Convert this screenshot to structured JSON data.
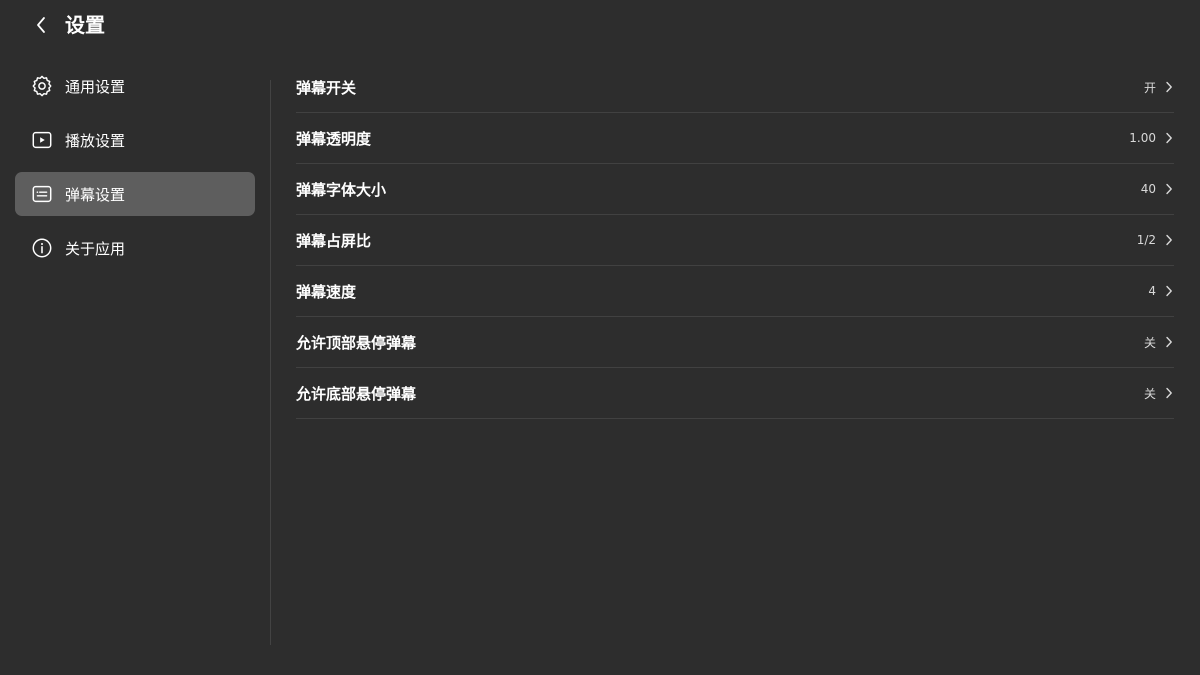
{
  "header": {
    "title": "设置",
    "back_icon": "chevron-left-icon"
  },
  "sidebar": {
    "items": [
      {
        "label": "通用设置",
        "icon": "gear-icon",
        "active": false
      },
      {
        "label": "播放设置",
        "icon": "play-icon",
        "active": false
      },
      {
        "label": "弹幕设置",
        "icon": "danmaku-icon",
        "active": true
      },
      {
        "label": "关于应用",
        "icon": "info-icon",
        "active": false
      }
    ]
  },
  "content": {
    "rows": [
      {
        "label": "弹幕开关",
        "value": "开"
      },
      {
        "label": "弹幕透明度",
        "value": "1.00"
      },
      {
        "label": "弹幕字体大小",
        "value": "40"
      },
      {
        "label": "弹幕占屏比",
        "value": "1/2"
      },
      {
        "label": "弹幕速度",
        "value": "4"
      },
      {
        "label": "允许顶部悬停弹幕",
        "value": "关"
      },
      {
        "label": "允许底部悬停弹幕",
        "value": "关"
      }
    ]
  },
  "colors": {
    "background": "#2d2d2d",
    "active_item": "#5e5e5e",
    "divider": "#414141",
    "text": "#ffffff"
  }
}
